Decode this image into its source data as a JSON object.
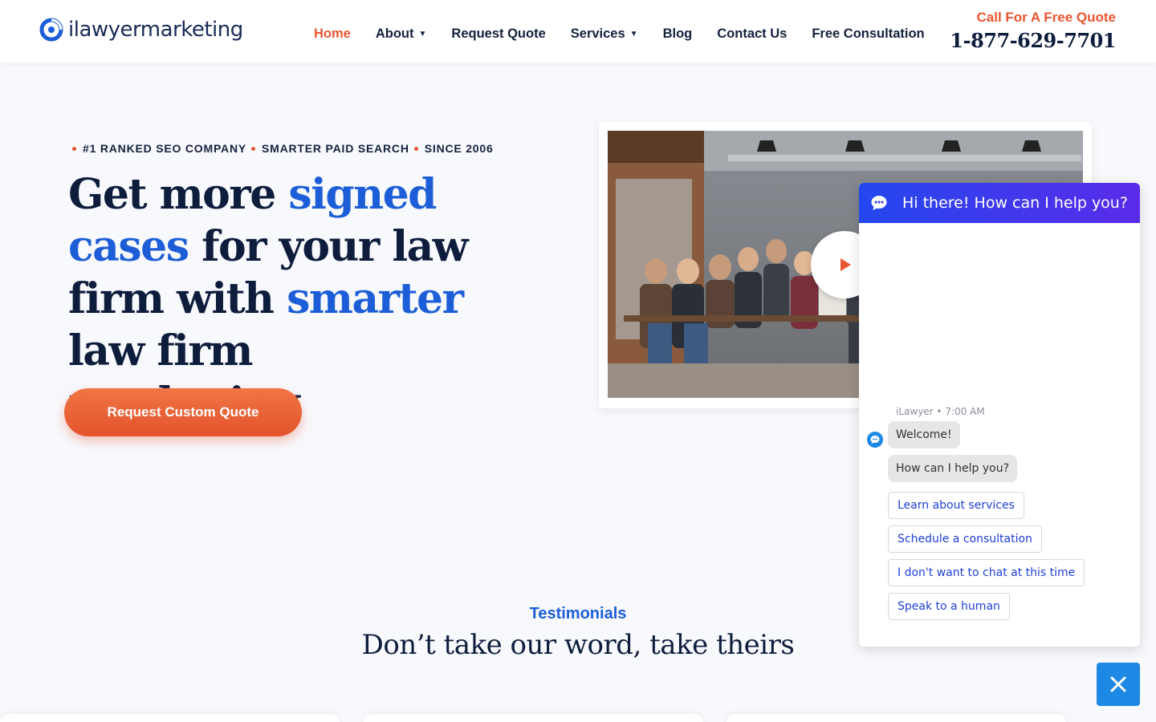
{
  "header": {
    "logo_text": "ilawyermarketing",
    "nav": [
      {
        "label": "Home",
        "active": true,
        "dropdown": false
      },
      {
        "label": "About",
        "active": false,
        "dropdown": true
      },
      {
        "label": "Request Quote",
        "active": false,
        "dropdown": false
      },
      {
        "label": "Services",
        "active": false,
        "dropdown": true
      },
      {
        "label": "Blog",
        "active": false,
        "dropdown": false
      },
      {
        "label": "Contact Us",
        "active": false,
        "dropdown": false
      },
      {
        "label": "Free Consultation",
        "active": false,
        "dropdown": false
      }
    ],
    "call_label": "Call For A Free Quote",
    "phone": "1-877-629-7701"
  },
  "hero": {
    "taglines": [
      "#1 RANKED SEO COMPANY",
      "SMARTER PAID SEARCH",
      "SINCE 2006"
    ],
    "headline": {
      "p1": "Get more ",
      "h1": "signed",
      "p2": "cases",
      "p3": " for your law firm with ",
      "h2": "smarter",
      "p4": " law firm marketing"
    },
    "cta_label": "Request Custom Quote"
  },
  "testimonials": {
    "label": "Testimonials",
    "title": "Don’t take our word, take theirs"
  },
  "chat": {
    "header_title": "Hi there! How can I help you?",
    "meta": "iLawyer • 7:00 AM",
    "messages": [
      "Welcome!",
      "How can I help you?"
    ],
    "quick_replies": [
      "Learn about services",
      "Schedule a consultation",
      "I don't want to chat at this time",
      "Speak to a human"
    ]
  },
  "colors": {
    "accent_orange": "#e9552f",
    "accent_blue": "#1d5ed8",
    "navy": "#0f1d3d",
    "chat_gradient_start": "#2447ef",
    "chat_gradient_end": "#5a2bea",
    "chat_close": "#1e88e5"
  },
  "icons": {
    "logo": "ilawyer-swirl-icon",
    "play": "play-icon",
    "chat_header": "chat-bubble-icon",
    "bot_avatar": "bot-avatar-icon",
    "close": "close-icon"
  }
}
